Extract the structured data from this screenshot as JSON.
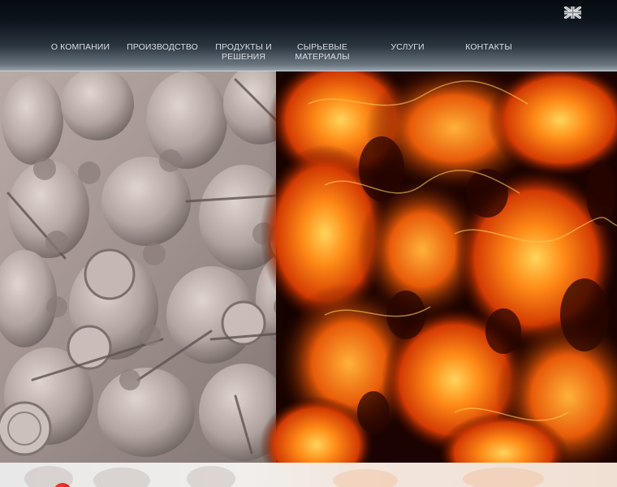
{
  "header": {
    "language_switch": {
      "icon": "uk-flag-icon"
    }
  },
  "nav": {
    "items": [
      {
        "label": "О КОМПАНИИ"
      },
      {
        "label": "ПРОИЗВОДСТВО"
      },
      {
        "label": "ПРОДУКТЫ И\nРЕШЕНИЯ"
      },
      {
        "label": "СЫРЬЕВЫЕ\nМАТЕРИАЛЫ"
      },
      {
        "label": "УСЛУГИ"
      },
      {
        "label": "КОНТАКТЫ"
      }
    ]
  },
  "hero": {
    "image": "stone-warriors-relief-and-fire-banner"
  },
  "colors": {
    "header_dark": "#060b11",
    "header_light": "#9aa3ab",
    "nav_text": "#d8dde1",
    "stone": "#a99b96",
    "fire_orange": "#ff7a12",
    "fire_red": "#c42a02",
    "accent_red": "#c41208"
  }
}
